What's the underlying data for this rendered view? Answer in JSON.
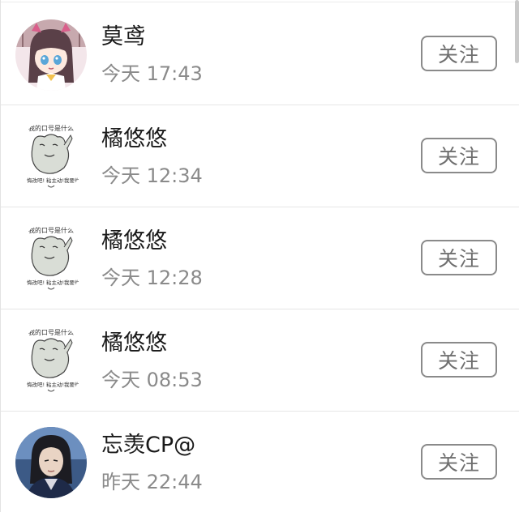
{
  "follow_list": [
    {
      "name": "莫鸢",
      "time": "今天 17:43",
      "button": "关注",
      "avatar": "anime-girl-avatar"
    },
    {
      "name": "橘悠悠",
      "time": "今天 12:34",
      "button": "关注",
      "avatar": "cartoon-cat-meme-avatar"
    },
    {
      "name": "橘悠悠",
      "time": "今天 12:28",
      "button": "关注",
      "avatar": "cartoon-cat-meme-avatar"
    },
    {
      "name": "橘悠悠",
      "time": "今天 08:53",
      "button": "关注",
      "avatar": "cartoon-cat-meme-avatar"
    },
    {
      "name": "忘羡CP@",
      "time": "昨天 22:44",
      "button": "关注",
      "avatar": "costume-man-photo-avatar"
    }
  ],
  "avatar_meme_text": {
    "top": "我的口号是什么",
    "left": "悔改吧!",
    "middle": "粘主动!",
    "right": "我要你"
  }
}
